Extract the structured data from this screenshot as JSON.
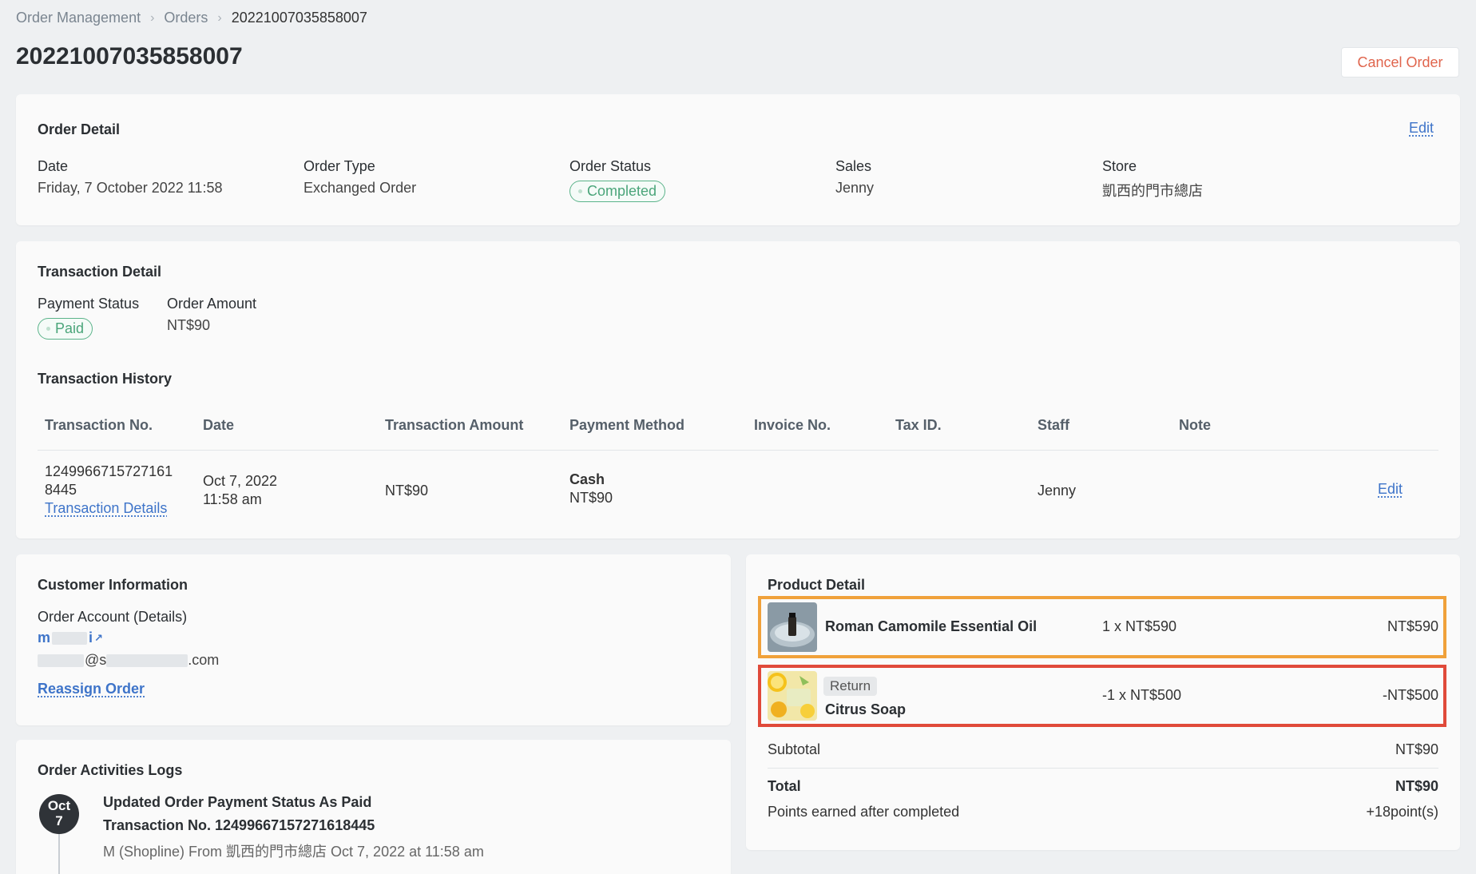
{
  "breadcrumb": {
    "root": "Order Management",
    "parent": "Orders",
    "current": "20221007035858007"
  },
  "page": {
    "title": "20221007035858007",
    "cancel_label": "Cancel Order"
  },
  "order_detail": {
    "title": "Order Detail",
    "edit_label": "Edit",
    "fields": [
      {
        "label": "Date",
        "value": "Friday, 7 October 2022 11:58"
      },
      {
        "label": "Order Type",
        "value": "Exchanged Order"
      },
      {
        "label": "Order Status",
        "value": "Completed"
      },
      {
        "label": "Sales",
        "value": "Jenny"
      },
      {
        "label": "Store",
        "value": "凱西的門市總店"
      }
    ]
  },
  "transaction_detail": {
    "title": "Transaction Detail",
    "payment_status_label": "Payment Status",
    "payment_status_value": "Paid",
    "order_amount_label": "Order Amount",
    "order_amount_value": "NT$90",
    "history_title": "Transaction History",
    "columns": [
      "Transaction No.",
      "Date",
      "Transaction Amount",
      "Payment Method",
      "Invoice No.",
      "Tax ID.",
      "Staff",
      "Note"
    ],
    "row": {
      "txn_no_line1": "1249966715727161",
      "txn_no_line2": "8445",
      "details_link": "Transaction Details",
      "date_line1": "Oct 7, 2022",
      "date_line2": "11:58 am",
      "amount": "NT$90",
      "method": "Cash",
      "method_amount": "NT$90",
      "staff": "Jenny",
      "edit_label": "Edit"
    }
  },
  "customer": {
    "title": "Customer Information",
    "account_label": "Order Account (Details)",
    "account_name_start": "m",
    "account_name_end": "i",
    "email_mid": "@s",
    "email_end": ".com",
    "reassign_label": "Reassign Order"
  },
  "activity": {
    "title": "Order Activities Logs",
    "date_month": "Oct",
    "date_day": "7",
    "event_title": "Updated Order Payment Status As Paid",
    "event_sub": "Transaction No. 12499667157271618445",
    "event_meta": "M (Shopline) From 凱西的門市總店 Oct 7, 2022 at 11:58 am"
  },
  "product_detail": {
    "title": "Product Detail",
    "items": [
      {
        "name": "Roman Camomile Essential Oil",
        "qty_price": "1 x NT$590",
        "total": "NT$590",
        "badge": ""
      },
      {
        "name": "Citrus Soap",
        "qty_price": "-1 x NT$500",
        "total": "-NT$500",
        "badge": "Return"
      }
    ],
    "subtotal_label": "Subtotal",
    "subtotal_value": "NT$90",
    "total_label": "Total",
    "total_value": "NT$90",
    "points_label": "Points earned after completed",
    "points_value": "+18point(s)"
  },
  "colors": {
    "highlight_orange": "#f0a13a",
    "highlight_red": "#e04a3a",
    "link_blue": "#3e74c9",
    "status_green": "#4aa57a",
    "cancel_red": "#e0654d"
  }
}
